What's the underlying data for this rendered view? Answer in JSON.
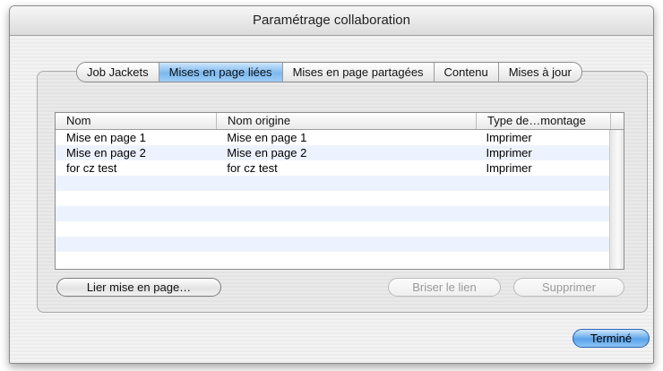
{
  "window": {
    "title": "Paramétrage collaboration"
  },
  "tabs": [
    {
      "label": "Job Jackets",
      "selected": false
    },
    {
      "label": "Mises en page liées",
      "selected": true
    },
    {
      "label": "Mises en page partagées",
      "selected": false
    },
    {
      "label": "Contenu",
      "selected": false
    },
    {
      "label": "Mises à jour",
      "selected": false
    }
  ],
  "table": {
    "columns": [
      "Nom",
      "Nom origine",
      "Type de…montage"
    ],
    "rows": [
      [
        "Mise en page 1",
        "Mise en page 1",
        "Imprimer"
      ],
      [
        "Mise en page 2",
        "Mise en page 2",
        "Imprimer"
      ],
      [
        "for cz test",
        "for cz test",
        "Imprimer"
      ]
    ]
  },
  "buttons": {
    "link": "Lier mise en page…",
    "break_link": "Briser le lien",
    "delete": "Supprimer",
    "done": "Terminé"
  },
  "colors": {
    "selected_tab": "#7cb9f0",
    "default_button": "#5aa3ea",
    "row_stripe": "#edf3fe"
  }
}
